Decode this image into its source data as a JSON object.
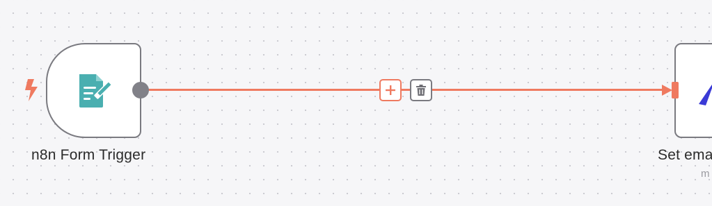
{
  "workflow": {
    "nodes": {
      "trigger": {
        "label": "n8n Form Trigger",
        "icon": "form-edit-icon"
      },
      "set_node": {
        "label": "Set ema",
        "sublabel": "m",
        "icon": "set-icon"
      }
    },
    "connection": {
      "add_icon": "plus-icon",
      "delete_icon": "trash-icon"
    }
  },
  "colors": {
    "canvas_bg": "#f6f6f8",
    "node_border": "#7a7a80",
    "connection": "#ef7a60",
    "trigger_icon": "#4aafb0",
    "set_icon": "#3a3ad6"
  }
}
